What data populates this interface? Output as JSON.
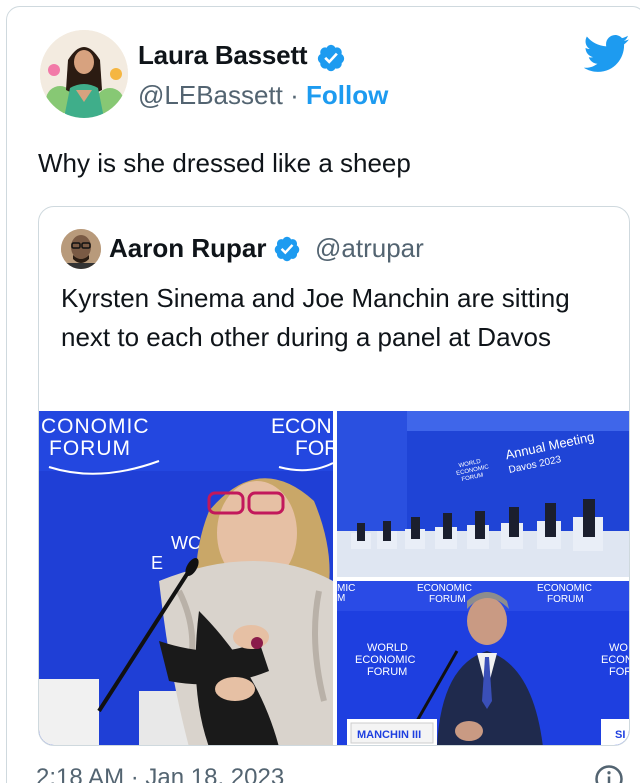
{
  "author": {
    "name": "Laura Bassett",
    "handle": "@LEBassett",
    "separator": "·",
    "follow_label": "Follow"
  },
  "tweet": {
    "text": "Why is she dressed like a sheep",
    "timestamp": "2:18 AM · Jan 18, 2023"
  },
  "quoted": {
    "name": "Aaron Rupar",
    "handle": "@atrupar",
    "text": "Kyrsten Sinema and Joe Manchin are sitting next to each other during a panel at Davos"
  },
  "images": {
    "img1": {
      "logo_line1": "CONOMIC",
      "logo_line2": "FORUM",
      "logo_right1": "ECON",
      "logo_right2": "FOR",
      "bg_text1": "WC",
      "bg_text2": "E"
    },
    "img2": {
      "logo_line1": "WORLD",
      "logo_line2": "ECONOMIC",
      "logo_line3": "FORUM",
      "title": "Annual Meeting",
      "subtitle": "Davos 2023"
    },
    "img3": {
      "top_left": "MIC",
      "top_left2": "M",
      "top_mid1": "ECONOMIC",
      "top_mid2": "FORUM",
      "top_right1": "ECONOMIC",
      "top_right2": "FORUM",
      "center1": "WORLD",
      "center2": "ECONOMIC",
      "center3": "FORUM",
      "right1": "WO",
      "right2": "ECON",
      "right3": "FOR",
      "nameplate": "MANCHIN III",
      "nameplate_right": "SI"
    }
  },
  "colors": {
    "accent": "#1d9bf0",
    "text": "#0f1419",
    "secondary": "#536471",
    "border": "#cfd9de",
    "stage_blue": "#1f3fd6"
  },
  "icons": {
    "verified": "verified-badge-icon",
    "twitter": "twitter-bird-icon",
    "info": "info-icon"
  }
}
